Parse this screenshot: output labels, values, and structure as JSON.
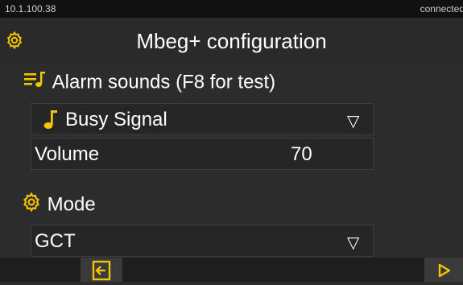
{
  "status": {
    "ip": "10.1.100.38",
    "connection": "connected"
  },
  "header": {
    "title": "Mbeg+ configuration",
    "icon": "gear-icon"
  },
  "alarm": {
    "heading": "Alarm sounds (F8 for test)",
    "heading_icon": "playlist-music-icon",
    "sound": {
      "icon": "music-note-icon",
      "value": "Busy Signal"
    },
    "volume": {
      "label": "Volume",
      "value": "70"
    }
  },
  "mode": {
    "heading": "Mode",
    "heading_icon": "gear-icon",
    "value": "GCT"
  },
  "footer": {
    "back_icon": "exit-icon",
    "next_icon": "play-icon"
  },
  "colors": {
    "accent": "#f5c400",
    "background": "#2c2c2c",
    "statusbar": "#111111"
  }
}
